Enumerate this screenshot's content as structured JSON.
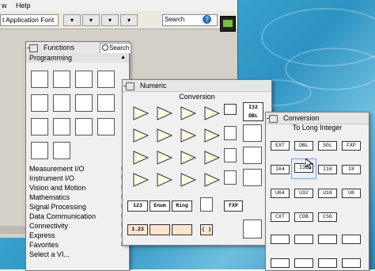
{
  "menubar": {
    "items": [
      "w",
      "Help"
    ]
  },
  "toolbar": {
    "font_selector": "t Application Font",
    "search_placeholder": "Search",
    "search_icon_glyph": "?"
  },
  "functions_palette": {
    "title": "Functions",
    "search_label": "Search",
    "open_category": "Programming",
    "categories": [
      "Measurement I/O",
      "Instrument I/O",
      "Vision and Motion",
      "Mathematics",
      "Signal Processing",
      "Data Communication",
      "Connectivity",
      "Express",
      "Favorites",
      "Select a VI..."
    ]
  },
  "numeric_palette": {
    "title": "Numeric",
    "subtitle": "Conversion",
    "side_labels": [
      "I32",
      "DBL"
    ],
    "row5_labels": [
      "123",
      "Enum",
      "Ring"
    ],
    "row5_right": "FXP",
    "row6_labels": [
      "1.23",
      "",
      "",
      "( )"
    ]
  },
  "conversion_palette": {
    "title": "Conversion",
    "subtitle": "To Long Integer",
    "rows": [
      [
        "EXT",
        "DBL",
        "SGL",
        "FXP"
      ],
      [
        "I64",
        "I32",
        "I16",
        "I8"
      ],
      [
        "U64",
        "U32",
        "U16",
        "U8"
      ],
      [
        "CXT",
        "CDB",
        "CSG",
        ""
      ],
      [
        "",
        "",
        "",
        ""
      ],
      [
        "",
        "",
        "",
        ""
      ]
    ]
  },
  "colors": {
    "desktop": "#2e93c2",
    "palette_bg": "#f0f0f0",
    "selected_border": "#4a78c8"
  }
}
